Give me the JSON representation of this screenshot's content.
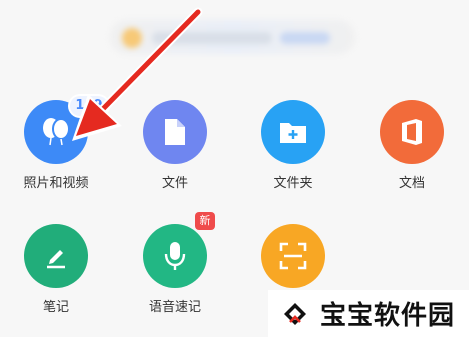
{
  "tiles": [
    {
      "label": "照片和视频",
      "color": "#3d8af7",
      "icon": "balloon-icon",
      "badge": "109"
    },
    {
      "label": "文件",
      "color": "#6f86f0",
      "icon": "file-icon"
    },
    {
      "label": "文件夹",
      "color": "#28a2f4",
      "icon": "folder-add-icon"
    },
    {
      "label": "文档",
      "color": "#f26b3a",
      "icon": "office-icon"
    },
    {
      "label": "笔记",
      "color": "#21ad7a",
      "icon": "pencil-icon"
    },
    {
      "label": "语音速记",
      "color": "#22b784",
      "icon": "microphone-icon",
      "badge": "新"
    },
    {
      "label": "",
      "color": "#f8a724",
      "icon": "scan-icon"
    }
  ],
  "watermark": {
    "text": "宝宝软件园"
  },
  "annotation": {
    "arrow_color": "#e52a20"
  }
}
